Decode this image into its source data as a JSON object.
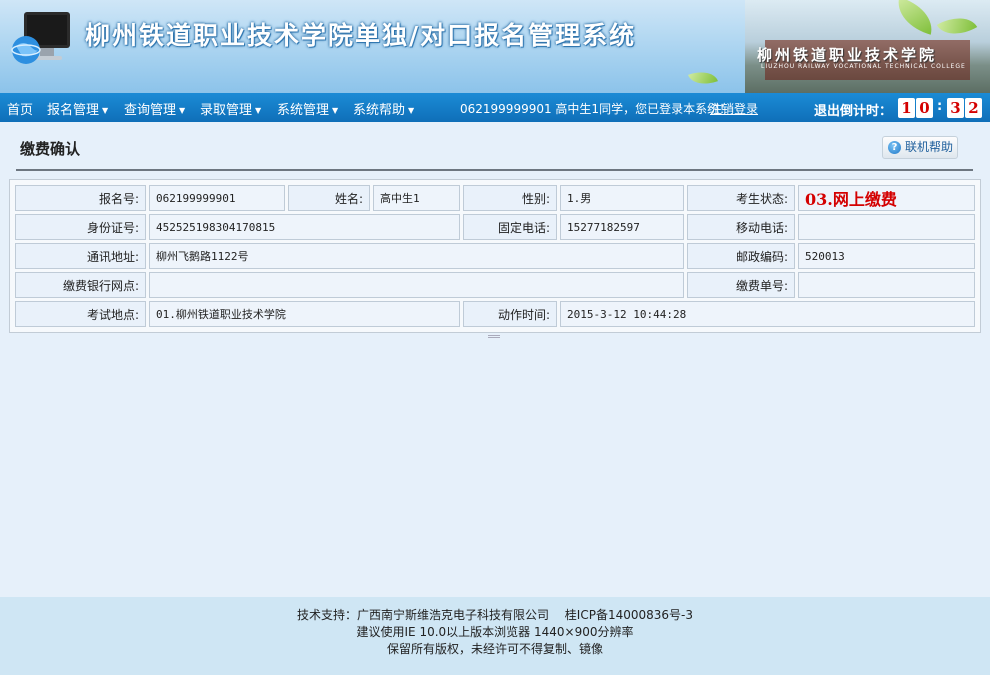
{
  "header": {
    "title": "柳州铁道职业技术学院单独/对口报名管理系统",
    "campus_name": "柳州铁道职业技术学院",
    "campus_en": "LIUZHOU RAILWAY VOCATIONAL TECHNICAL COLLEGE"
  },
  "nav": {
    "items": [
      {
        "label": "首页",
        "has_caret": false
      },
      {
        "label": "报名管理",
        "has_caret": true
      },
      {
        "label": "查询管理",
        "has_caret": true
      },
      {
        "label": "录取管理",
        "has_caret": true
      },
      {
        "label": "系统管理",
        "has_caret": true
      },
      {
        "label": "系统帮助",
        "has_caret": true
      }
    ],
    "login_info": "062199999901 高中生1同学，您已登录本系统！",
    "logout_label": "注销登录",
    "countdown_label": "退出倒计时：",
    "countdown_digits": [
      "1",
      "0",
      "3",
      "2"
    ]
  },
  "page": {
    "title": "缴费确认",
    "help_label": "联机帮助"
  },
  "info": {
    "reg_no_label": "报名号:",
    "reg_no": "062199999901",
    "name_label": "姓名:",
    "name": "高中生1",
    "gender_label": "性别:",
    "gender": "1.男",
    "status_label": "考生状态:",
    "status": "03.网上缴费",
    "id_label": "身份证号:",
    "id_no": "452525198304170815",
    "phone_label": "固定电话:",
    "phone": "15277182597",
    "mobile_label": "移动电话:",
    "mobile": "",
    "address_label": "通讯地址:",
    "address": "柳州飞鹅路1122号",
    "postcode_label": "邮政编码:",
    "postcode": "520013",
    "bank_label": "缴费银行网点:",
    "bank": "",
    "receipt_label": "缴费单号:",
    "receipt": "",
    "exam_site_label": "考试地点:",
    "exam_site": "01.柳州铁道职业技术学院",
    "action_time_label": "动作时间:",
    "action_time": "2015-3-12 10:44:28"
  },
  "footer": {
    "line1": "技术支持：广西南宁斯维浩克电子科技有限公司　 桂ICP备14000836号-3",
    "line2": "建议使用IE 10.0以上版本浏览器 1440×900分辨率",
    "line3": "保留所有版权，未经许可不得复制、镜像"
  },
  "colors": {
    "nav_bg": "#0f6fb8",
    "status_red": "#d40000",
    "page_bg": "#e6f0fa"
  }
}
